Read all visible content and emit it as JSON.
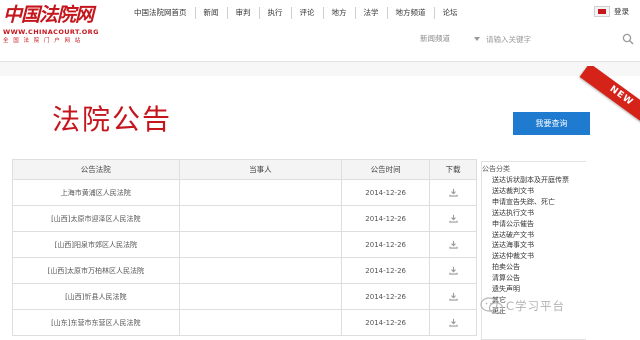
{
  "logo": {
    "mark": "中国法院网",
    "url": "WWW.CHINACOURT.ORG",
    "tagline": "全 国 法 院 门 户 网 站"
  },
  "nav": {
    "items": [
      "中国法院网首页",
      "新闻",
      "审判",
      "执行",
      "评论",
      "地方",
      "法学",
      "地方频道",
      "论坛"
    ],
    "login": "登录"
  },
  "search": {
    "channel": "新闻频道",
    "placeholder": "请输入关键字"
  },
  "page": {
    "title": "法院公告",
    "query_button": "我要查询",
    "ribbon": "NEW"
  },
  "table": {
    "headers": [
      "公告法院",
      "当事人",
      "公告时间",
      "下载"
    ],
    "rows": [
      {
        "court": "上海市黄浦区人民法院",
        "party": "",
        "date": "2014-12-26"
      },
      {
        "court": "[山西]太原市迎泽区人民法院",
        "party": "",
        "date": "2014-12-26"
      },
      {
        "court": "[山西]阳泉市郊区人民法院",
        "party": "",
        "date": "2014-12-26"
      },
      {
        "court": "[山西]太原市万柏林区人民法院",
        "party": "",
        "date": "2014-12-26"
      },
      {
        "court": "[山西]忻县人民法院",
        "party": "",
        "date": "2014-12-26"
      },
      {
        "court": "[山东]东营市东营区人民法院",
        "party": "",
        "date": "2014-12-26"
      }
    ]
  },
  "category": {
    "header": "公告分类",
    "items": [
      "送达诉状副本及开庭传票",
      "送达裁判文书",
      "申请宣告失踪、死亡",
      "送达执行文书",
      "申请公示催告",
      "送达破产文书",
      "送达海事文书",
      "送达仲裁文书",
      "拍卖公告",
      "清算公告",
      "遗失声明",
      "其它",
      "更正"
    ]
  },
  "watermark": {
    "text": "C学习平台"
  },
  "colors": {
    "brand_red": "#c4161c",
    "button_blue": "#1e7bd0",
    "ribbon_red": "#d5231a"
  }
}
